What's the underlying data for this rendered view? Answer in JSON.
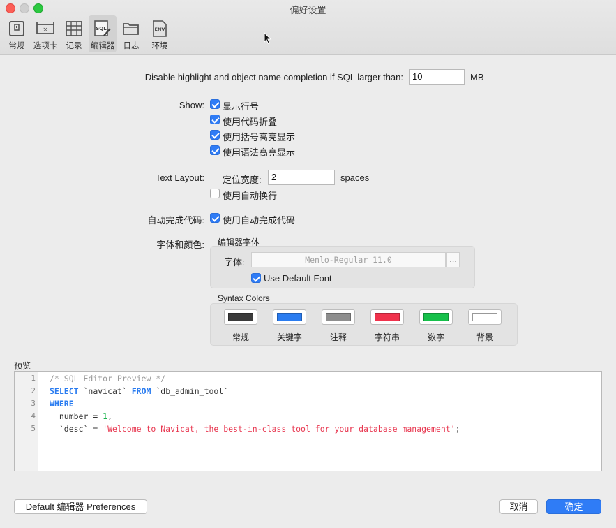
{
  "window": {
    "title": "偏好设置"
  },
  "toolbar": {
    "items": [
      {
        "label": "常规",
        "icon": "general-icon"
      },
      {
        "label": "选项卡",
        "icon": "tabs-icon"
      },
      {
        "label": "记录",
        "icon": "grid-icon"
      },
      {
        "label": "编辑器",
        "icon": "sql-editor-icon"
      },
      {
        "label": "日志",
        "icon": "folder-icon"
      },
      {
        "label": "环境",
        "icon": "env-icon"
      }
    ],
    "active_index": 3
  },
  "sql_limit": {
    "label": "Disable highlight and object name completion if SQL larger than:",
    "value": "10",
    "unit": "MB"
  },
  "show": {
    "label": "Show:",
    "options": [
      {
        "label": "显示行号",
        "checked": true
      },
      {
        "label": "使用代码折叠",
        "checked": true
      },
      {
        "label": "使用括号高亮显示",
        "checked": true
      },
      {
        "label": "使用语法高亮显示",
        "checked": true
      }
    ]
  },
  "text_layout": {
    "label": "Text Layout:",
    "tab_width_label": "定位宽度:",
    "tab_width_value": "2",
    "tab_width_unit": "spaces",
    "word_wrap_label": "使用自动换行",
    "word_wrap_checked": false
  },
  "autocomplete": {
    "label": "自动完成代码:",
    "option_label": "使用自动完成代码",
    "checked": true
  },
  "font_color": {
    "label": "字体和颜色:",
    "editor_font_title": "编辑器字体",
    "font_label": "字体:",
    "font_value": "Menlo-Regular 11.0",
    "font_browse": "...",
    "use_default_label": "Use Default Font",
    "use_default_checked": true,
    "syntax_title": "Syntax Colors",
    "swatches": [
      {
        "label": "常规",
        "color": "#3a3a3a"
      },
      {
        "label": "关键字",
        "color": "#2a7cf0"
      },
      {
        "label": "注释",
        "color": "#8e8e8e"
      },
      {
        "label": "字符串",
        "color": "#f0324c"
      },
      {
        "label": "数字",
        "color": "#16c04a"
      },
      {
        "label": "背景",
        "color": "#ffffff"
      }
    ]
  },
  "preview": {
    "label": "预览",
    "line_numbers": [
      "1",
      "2",
      "3",
      "4",
      "5"
    ],
    "code": {
      "l1_comment": "/* SQL Editor Preview */",
      "l2_kw1": "SELECT",
      "l2_id1": " `navicat` ",
      "l2_kw2": "FROM",
      "l2_id2": " `db_admin_tool`",
      "l3_kw": "WHERE",
      "l4_pre": "  number = ",
      "l4_num": "1",
      "l4_post": ",",
      "l5_pre": "  `desc` = ",
      "l5_str": "'Welcome to Navicat, the best-in-class tool for your database management'",
      "l5_post": ";"
    }
  },
  "footer": {
    "defaults_button": "Default 编辑器 Preferences",
    "cancel_button": "取消",
    "ok_button": "确定"
  }
}
